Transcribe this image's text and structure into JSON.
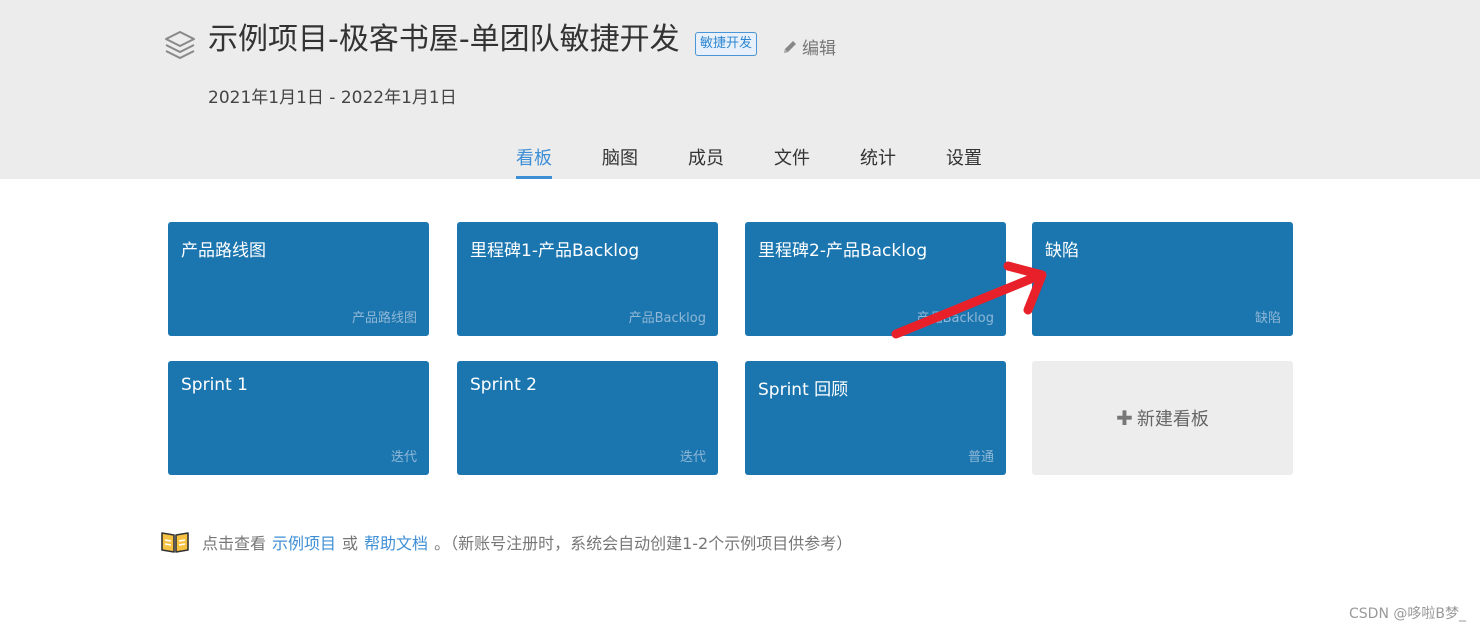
{
  "project": {
    "title": "示例项目-极客书屋-单团队敏捷开发",
    "tag": "敏捷开发",
    "edit_label": "编辑",
    "date_range": "2021年1月1日 - 2022年1月1日",
    "icon": "layers-icon"
  },
  "tabs": [
    {
      "label": "看板",
      "active": true
    },
    {
      "label": "脑图",
      "active": false
    },
    {
      "label": "成员",
      "active": false
    },
    {
      "label": "文件",
      "active": false
    },
    {
      "label": "统计",
      "active": false
    },
    {
      "label": "设置",
      "active": false
    }
  ],
  "boards": [
    {
      "name": "产品路线图",
      "type": "产品路线图"
    },
    {
      "name": "里程碑1-产品Backlog",
      "type": "产品Backlog"
    },
    {
      "name": "里程碑2-产品Backlog",
      "type": "产品Backlog"
    },
    {
      "name": "缺陷",
      "type": "缺陷"
    },
    {
      "name": "Sprint 1",
      "type": "迭代"
    },
    {
      "name": "Sprint 2",
      "type": "迭代"
    },
    {
      "name": "Sprint 回顾",
      "type": "普通"
    }
  ],
  "new_board": {
    "plus": "✚",
    "label": "新建看板"
  },
  "help": {
    "prefix": "点击查看",
    "link1": "示例项目",
    "or": "或",
    "link2": "帮助文档",
    "suffix": "。（新账号注册时，系统会自动创建1-2个示例项目供参考）",
    "icon": "book-icon"
  },
  "watermark": "CSDN @哆啦B梦_",
  "colors": {
    "board_bg": "#1b76b0",
    "accent": "#3f8fd6",
    "header_bg": "#ececed",
    "annotation_arrow": "#e8202a"
  }
}
